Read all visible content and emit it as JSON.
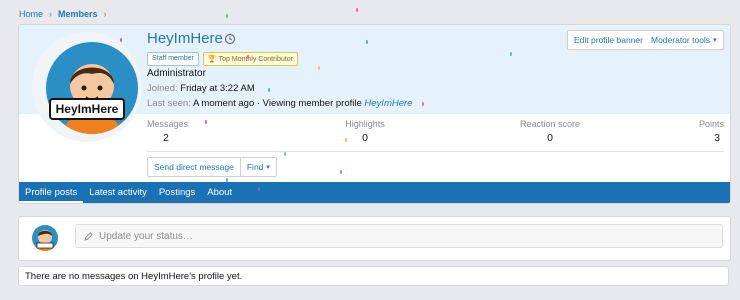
{
  "breadcrumb": {
    "home": "Home",
    "members": "Members"
  },
  "profile": {
    "username": "HeyImHere",
    "avatar_label": "HeyImHere",
    "badges": {
      "staff": "Staff member",
      "top": "Top Monthly Contributor"
    },
    "role": "Administrator",
    "joined_label": "Joined:",
    "joined_value": "Friday at 3:22 AM",
    "last_seen_label": "Last seen:",
    "last_seen_value": "A moment ago · Viewing member profile",
    "last_seen_link": "HeyImHere"
  },
  "buttons": {
    "edit_banner": "Edit profile banner",
    "mod_tools": "Moderator tools"
  },
  "stats": [
    {
      "label": "Messages",
      "value": "2"
    },
    {
      "label": "Highlights",
      "value": "0"
    },
    {
      "label": "Reaction score",
      "value": "0"
    },
    {
      "label": "Points",
      "value": "3"
    }
  ],
  "actions": {
    "send_dm": "Send direct message",
    "find": "Find"
  },
  "tabs": [
    {
      "label": "Profile posts"
    },
    {
      "label": "Latest activity"
    },
    {
      "label": "Postings"
    },
    {
      "label": "About"
    }
  ],
  "status": {
    "placeholder": "Update your status…"
  },
  "empty_message": "There are no messages on HeyImHere's profile yet.",
  "icons": {
    "history": "history-icon",
    "trophy": "trophy-icon",
    "pencil": "pencil-icon",
    "dropdown": "chevron-down-icon"
  },
  "colors": {
    "accent": "#2577b1",
    "tab_bar": "#1a72b4",
    "banner": "#e6f2fb",
    "avatar_bg": "#2a8fc4"
  }
}
